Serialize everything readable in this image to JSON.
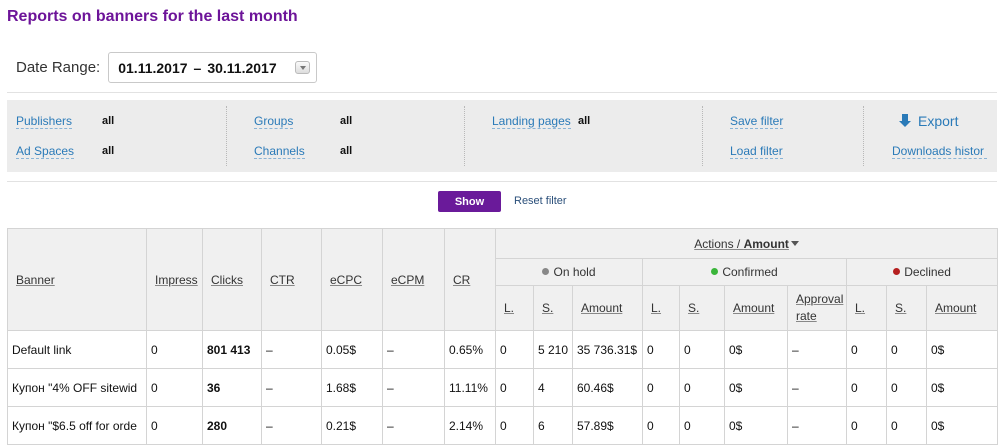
{
  "page": {
    "title": "Reports on banners for the last month"
  },
  "date_range": {
    "label": "Date Range:",
    "from": "01.11.2017",
    "separator": "–",
    "to": "30.11.2017"
  },
  "filters": {
    "publishers": {
      "label": "Publishers",
      "value": "all"
    },
    "ad_spaces": {
      "label": "Ad Spaces",
      "value": "all"
    },
    "groups": {
      "label": "Groups",
      "value": "all"
    },
    "channels": {
      "label": "Channels",
      "value": "all"
    },
    "landing_pages": {
      "label": "Landing pages",
      "value": "all"
    },
    "save_filter": "Save filter",
    "load_filter": "Load filter",
    "export": "Export",
    "downloads_history": "Downloads histor"
  },
  "actions": {
    "show": "Show",
    "reset": "Reset filter"
  },
  "table": {
    "headers": {
      "banner": "Banner",
      "impressions": "Impress",
      "clicks": "Clicks",
      "ctr": "CTR",
      "ecpc": "eCPC",
      "ecpm": "eCPM",
      "cr": "CR",
      "actions_prefix": "Actions / ",
      "actions_metric": "Amount",
      "on_hold": "On hold",
      "confirmed": "Confirmed",
      "declined": "Declined",
      "l": "L.",
      "s": "S.",
      "amount": "Amount",
      "approval_rate": "Approval rate"
    },
    "status_colors": {
      "on_hold": "#888888",
      "confirmed": "#3ab53a",
      "declined": "#b51f1f"
    },
    "rows": [
      {
        "banner": "Default link",
        "impressions": "0",
        "clicks": "801 413",
        "ctr": "–",
        "ecpc": "0.05$",
        "ecpm": "–",
        "cr": "0.65%",
        "hold_l": "0",
        "hold_s": "5 210",
        "hold_amount": "35 736.31$",
        "conf_l": "0",
        "conf_s": "0",
        "conf_amount": "0$",
        "approval": "–",
        "decl_l": "0",
        "decl_s": "0",
        "decl_amount": "0$"
      },
      {
        "banner": "Купон \"4% OFF sitewid",
        "impressions": "0",
        "clicks": "36",
        "ctr": "–",
        "ecpc": "1.68$",
        "ecpm": "–",
        "cr": "11.11%",
        "hold_l": "0",
        "hold_s": "4",
        "hold_amount": "60.46$",
        "conf_l": "0",
        "conf_s": "0",
        "conf_amount": "0$",
        "approval": "–",
        "decl_l": "0",
        "decl_s": "0",
        "decl_amount": "0$"
      },
      {
        "banner": "Купон \"$6.5 off for orde",
        "impressions": "0",
        "clicks": "280",
        "ctr": "–",
        "ecpc": "0.21$",
        "ecpm": "–",
        "cr": "2.14%",
        "hold_l": "0",
        "hold_s": "6",
        "hold_amount": "57.89$",
        "conf_l": "0",
        "conf_s": "0",
        "conf_amount": "0$",
        "approval": "–",
        "decl_l": "0",
        "decl_s": "0",
        "decl_amount": "0$"
      }
    ]
  }
}
